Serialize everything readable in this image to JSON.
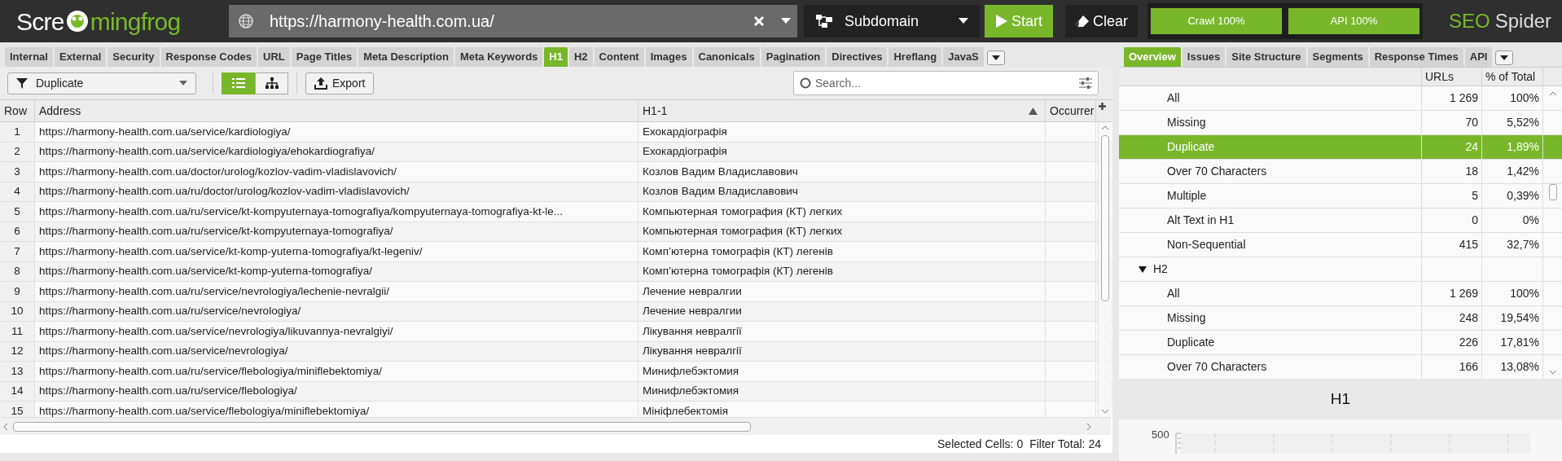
{
  "top_bar": {
    "logo": {
      "before": "Scre",
      "after": "mingfrog"
    },
    "url": "https://harmony-health.com.ua/",
    "mode": "Subdomain",
    "start": "Start",
    "clear": "Clear",
    "progress": [
      {
        "label": "Crawl 100%",
        "level": 1
      },
      {
        "label": "API 100%",
        "level": 1
      }
    ],
    "product": {
      "first": "SEO",
      "second": "Spider"
    }
  },
  "tabs": [
    {
      "label": "Internal",
      "selected": false
    },
    {
      "label": "External",
      "selected": false
    },
    {
      "label": "Security",
      "selected": false
    },
    {
      "label": "Response Codes",
      "selected": false
    },
    {
      "label": "URL",
      "selected": false
    },
    {
      "label": "Page Titles",
      "selected": false
    },
    {
      "label": "Meta Description",
      "selected": false
    },
    {
      "label": "Meta Keywords",
      "selected": false
    },
    {
      "label": "H1",
      "selected": true
    },
    {
      "label": "H2",
      "selected": false
    },
    {
      "label": "Content",
      "selected": false
    },
    {
      "label": "Images",
      "selected": false
    },
    {
      "label": "Canonicals",
      "selected": false
    },
    {
      "label": "Pagination",
      "selected": false
    },
    {
      "label": "Directives",
      "selected": false
    },
    {
      "label": "Hreflang",
      "selected": false
    },
    {
      "label": "JavaS",
      "selected": false
    }
  ],
  "toolbar": {
    "filter": "Duplicate",
    "views": [
      {
        "kind": "list",
        "selected": true
      },
      {
        "kind": "tree",
        "selected": false
      }
    ],
    "export": "Export",
    "search": {
      "placeholder": "Search..."
    }
  },
  "table": {
    "columns": [
      "Row",
      "Address",
      "H1-1",
      "Occurrer"
    ],
    "rows": [
      [
        "1",
        "https://harmony-health.com.ua/service/kardiologiya/",
        "Ехокардіографія"
      ],
      [
        "2",
        "https://harmony-health.com.ua/service/kardiologiya/ehokardiografiya/",
        "Ехокардіографія"
      ],
      [
        "3",
        "https://harmony-health.com.ua/doctor/urolog/kozlov-vadim-vladislavovich/",
        "Козлов Вадим Владиславович"
      ],
      [
        "4",
        "https://harmony-health.com.ua/ru/doctor/urolog/kozlov-vadim-vladislavovich/",
        "Козлов Вадим Владиславович"
      ],
      [
        "5",
        "https://harmony-health.com.ua/ru/service/kt-kompyuternaya-tomografiya/kompyuternaya-tomografiya-kt-le...",
        "Компьютерная томография (КТ) легких"
      ],
      [
        "6",
        "https://harmony-health.com.ua/ru/service/kt-kompyuternaya-tomografiya/",
        "Компьютерная томография (КТ) легких"
      ],
      [
        "7",
        "https://harmony-health.com.ua/service/kt-komp-yuterna-tomografiya/kt-legeniv/",
        "Комп’ютерна томографія (КТ) легенів"
      ],
      [
        "8",
        "https://harmony-health.com.ua/service/kt-komp-yuterna-tomografiya/",
        "Комп’ютерна томографія (КТ) легенів"
      ],
      [
        "9",
        "https://harmony-health.com.ua/ru/service/nevrologiya/lechenie-nevralgii/",
        "Лечение невралгии"
      ],
      [
        "10",
        "https://harmony-health.com.ua/ru/service/nevrologiya/",
        "Лечение невралгии"
      ],
      [
        "11",
        "https://harmony-health.com.ua/service/nevrologiya/likuvannya-nevralgiyi/",
        "Лікування невралгії"
      ],
      [
        "12",
        "https://harmony-health.com.ua/service/nevrologiya/",
        "Лікування невралгії"
      ],
      [
        "13",
        "https://harmony-health.com.ua/ru/service/flebologiya/miniflebektomiya/",
        "Минифлебэктомия"
      ],
      [
        "14",
        "https://harmony-health.com.ua/ru/service/flebologiya/",
        "Минифлебэктомия"
      ],
      [
        "15",
        "https://harmony-health.com.ua/service/flebologiya/miniflebektomiya/",
        "Мініфлебектомія"
      ]
    ]
  },
  "status_bar": {
    "selected_label": "Selected Cells:",
    "selected_value": "0",
    "filter_label": "Filter Total:",
    "filter_value": "24"
  },
  "side_tabs": [
    {
      "label": "Overview",
      "selected": true
    },
    {
      "label": "Issues",
      "selected": false
    },
    {
      "label": "Site Structure",
      "selected": false
    },
    {
      "label": "Segments",
      "selected": false
    },
    {
      "label": "Response Times",
      "selected": false
    },
    {
      "label": "API",
      "selected": false
    }
  ],
  "overview": {
    "columns": [
      "URLs",
      "% of Total"
    ],
    "items": [
      {
        "label": "All",
        "urls": "1 269",
        "pct": "100%",
        "selected": false
      },
      {
        "label": "Missing",
        "urls": "70",
        "pct": "5,52%",
        "selected": false
      },
      {
        "label": "Duplicate",
        "urls": "24",
        "pct": "1,89%",
        "selected": true
      },
      {
        "label": "Over 70 Characters",
        "urls": "18",
        "pct": "1,42%",
        "selected": false
      },
      {
        "label": "Multiple",
        "urls": "5",
        "pct": "0,39%",
        "selected": false
      },
      {
        "label": "Alt Text in H1",
        "urls": "0",
        "pct": "0%",
        "selected": false
      },
      {
        "label": "Non-Sequential",
        "urls": "415",
        "pct": "32,7%",
        "selected": false
      },
      {
        "label": "H2",
        "expanded": true,
        "children": [
          {
            "label": "All",
            "urls": "1 269",
            "pct": "100%",
            "selected": false
          },
          {
            "label": "Missing",
            "urls": "248",
            "pct": "19,54%",
            "selected": false
          },
          {
            "label": "Duplicate",
            "urls": "226",
            "pct": "17,81%",
            "selected": false
          },
          {
            "label": "Over 70 Characters",
            "urls": "166",
            "pct": "13,08%",
            "selected": false
          }
        ]
      }
    ]
  },
  "chart": {
    "title": "H1",
    "y_tick": "500"
  }
}
